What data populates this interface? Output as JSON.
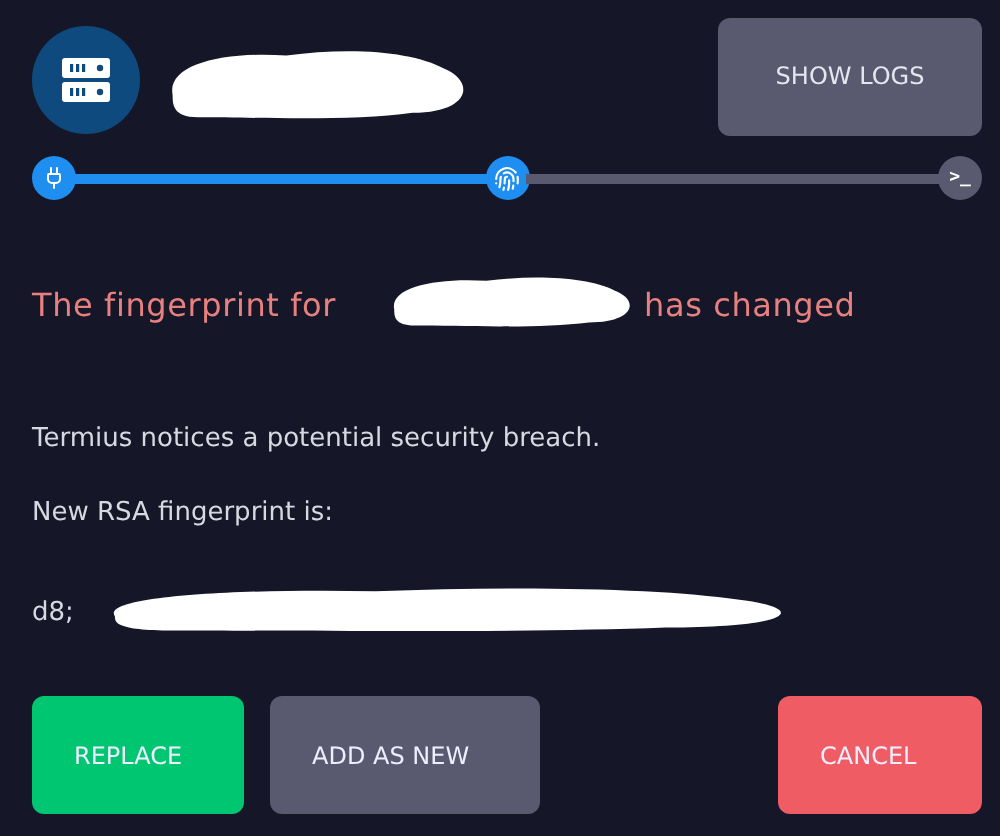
{
  "header": {
    "logs_button": "SHOW LOGS"
  },
  "steps": [
    {
      "kind": "connect",
      "done": true
    },
    {
      "kind": "fingerprint",
      "done": true
    },
    {
      "kind": "terminal",
      "done": false,
      "label": ">_"
    }
  ],
  "heading": {
    "before": "The fingerprint for",
    "after": "has changed"
  },
  "notice": "Termius notices a potential security breach.",
  "fingerprint_label": "New RSA fingerprint is:",
  "fingerprint_prefix": "d8;",
  "buttons": [
    {
      "kind": "primary",
      "label": "REPLACE"
    },
    {
      "kind": "secondary",
      "label": "ADD AS NEW"
    },
    {
      "kind": "danger",
      "label": "CANCEL"
    }
  ]
}
